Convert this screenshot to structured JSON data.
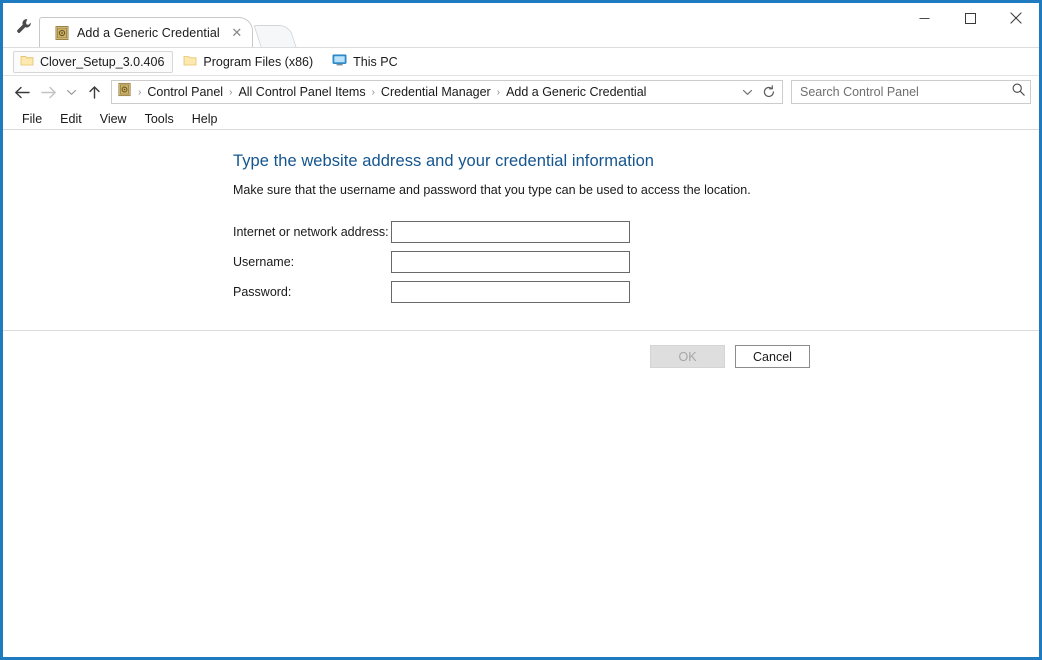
{
  "window": {
    "title": "Add a Generic Credential",
    "caption_buttons": [
      {
        "name": "minimize",
        "label": "–"
      },
      {
        "name": "maximize",
        "label": "□"
      },
      {
        "name": "close",
        "label": "✕"
      }
    ],
    "border_color": "#1f7bbf"
  },
  "tabs": {
    "tool_icon": "wrench-icon",
    "items": [
      {
        "label": "Add a Generic Credential",
        "favicon": "control-panel-icon",
        "close_label": "✕",
        "active": true
      }
    ],
    "new_tab_label": ""
  },
  "bookmarks": {
    "items": [
      {
        "label": "Clover_Setup_3.0.406",
        "icon": "folder-icon",
        "boxed": true
      },
      {
        "label": "Program Files (x86)",
        "icon": "folder-icon",
        "boxed": false
      },
      {
        "label": "This PC",
        "icon": "computer-icon",
        "boxed": false
      }
    ]
  },
  "navigation": {
    "back_label": "←",
    "forward_label": "→",
    "recent_label": "⌄",
    "up_label": "↑",
    "back_enabled": true,
    "forward_enabled": false,
    "address_icon": "control-panel-icon",
    "breadcrumbs": [
      "Control Panel",
      "All Control Panel Items",
      "Credential Manager",
      "Add a Generic Credential"
    ],
    "separator": "›",
    "dropdown_label": "⌄",
    "refresh_label": "↻"
  },
  "search": {
    "placeholder": "Search Control Panel",
    "value": "",
    "icon": "search-icon"
  },
  "menu": {
    "items": [
      "File",
      "Edit",
      "View",
      "Tools",
      "Help"
    ]
  },
  "page": {
    "heading": "Type the website address and your credential information",
    "subtitle": "Make sure that the username and password that you type can be used to access the location.",
    "heading_color": "#14558f",
    "fields": [
      {
        "label": "Internet or network address:",
        "value": "",
        "placeholder": "",
        "type": "text",
        "name": "internet-or-network-address-field"
      },
      {
        "label": "Username:",
        "value": "",
        "placeholder": "",
        "type": "text",
        "name": "username-field"
      },
      {
        "label": "Password:",
        "value": "",
        "placeholder": "",
        "type": "password",
        "name": "password-field"
      }
    ]
  },
  "buttons": {
    "ok": {
      "label": "OK",
      "enabled": false
    },
    "cancel": {
      "label": "Cancel",
      "enabled": true
    }
  }
}
